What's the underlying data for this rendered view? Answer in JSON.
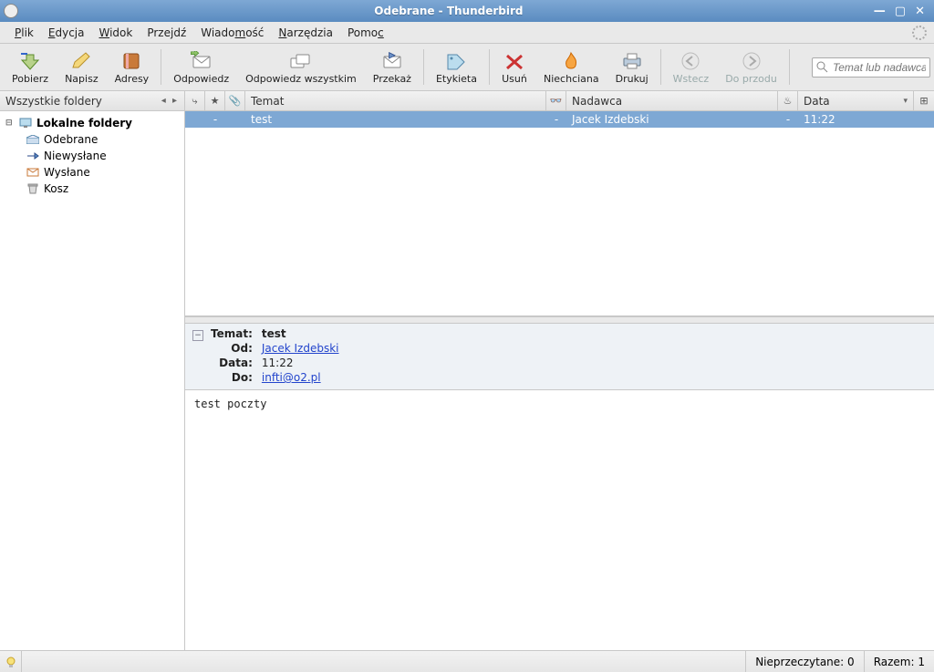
{
  "window": {
    "title": "Odebrane - Thunderbird"
  },
  "menu": {
    "plik": "Plik",
    "plik_m": "P",
    "edycja": "Edycja",
    "edycja_m": "E",
    "widok": "Widok",
    "widok_m": "W",
    "przejdz": "Przejdź",
    "przejdz_m": "j",
    "wiadomosc": "Wiadomość",
    "wiadomosc_m": "m",
    "narzedzia": "Narzędzia",
    "narzedzia_m": "N",
    "pomoc": "Pomoc",
    "pomoc_m": "c"
  },
  "toolbar": {
    "pobierz": "Pobierz",
    "napisz": "Napisz",
    "adresy": "Adresy",
    "odpowiedz": "Odpowiedz",
    "odpowiedz_wszystkim": "Odpowiedz wszystkim",
    "przekaz": "Przekaż",
    "etykieta": "Etykieta",
    "usun": "Usuń",
    "niechciana": "Niechciana",
    "drukuj": "Drukuj",
    "wstecz": "Wstecz",
    "do_przodu": "Do przodu",
    "search_placeholder": "Temat lub nadawca"
  },
  "sidebar": {
    "title": "Wszystkie foldery",
    "root": "Lokalne foldery",
    "items": [
      {
        "label": "Odebrane"
      },
      {
        "label": "Niewysłane"
      },
      {
        "label": "Wysłane"
      },
      {
        "label": "Kosz"
      }
    ]
  },
  "columns": {
    "temat": "Temat",
    "nadawca": "Nadawca",
    "data": "Data"
  },
  "messages": [
    {
      "subject": "test",
      "sender": "Jacek Izdebski",
      "date": "11:22"
    }
  ],
  "preview": {
    "labels": {
      "temat": "Temat:",
      "od": "Od:",
      "data": "Data:",
      "do": "Do:"
    },
    "subject": "test",
    "from": "Jacek Izdebski",
    "date": "11:22",
    "to": "infti@o2.pl",
    "body": "test poczty"
  },
  "status": {
    "unread_label": "Nieprzeczytane:",
    "unread_count": "0",
    "total_label": "Razem:",
    "total_count": "1"
  }
}
